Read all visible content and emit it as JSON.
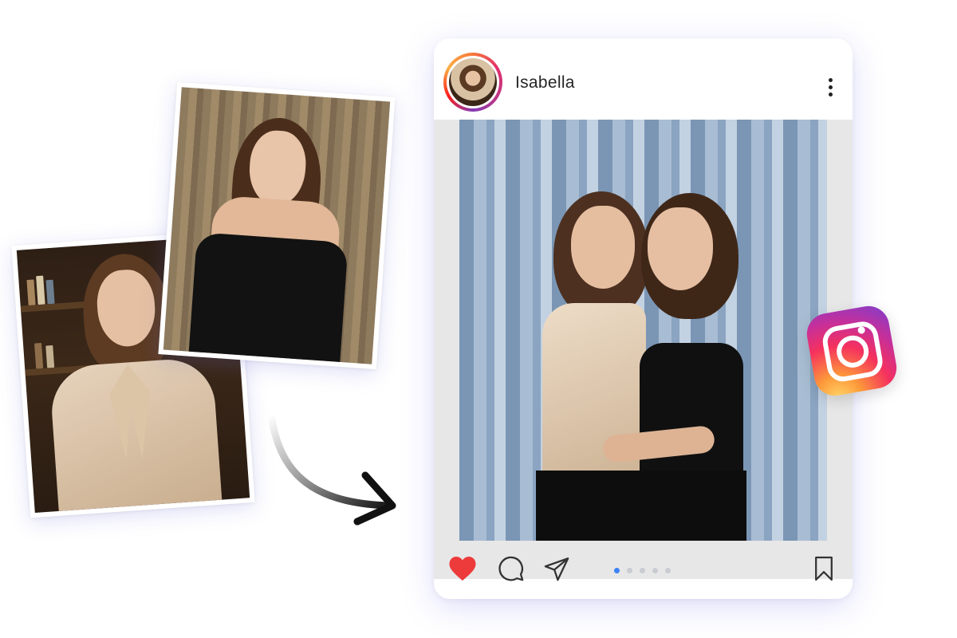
{
  "post": {
    "username": "Isabella",
    "slide_count": 5,
    "active_slide": 1,
    "liked": true
  },
  "colors": {
    "like": "#ed3a3a",
    "active_dot": "#3b82f6",
    "inactive_dot": "#c9ccd2"
  },
  "icons": {
    "more": "more-vertical-icon",
    "like": "heart-icon",
    "comment": "comment-icon",
    "share": "send-icon",
    "save": "bookmark-icon",
    "logo": "instagram-logo-icon"
  }
}
